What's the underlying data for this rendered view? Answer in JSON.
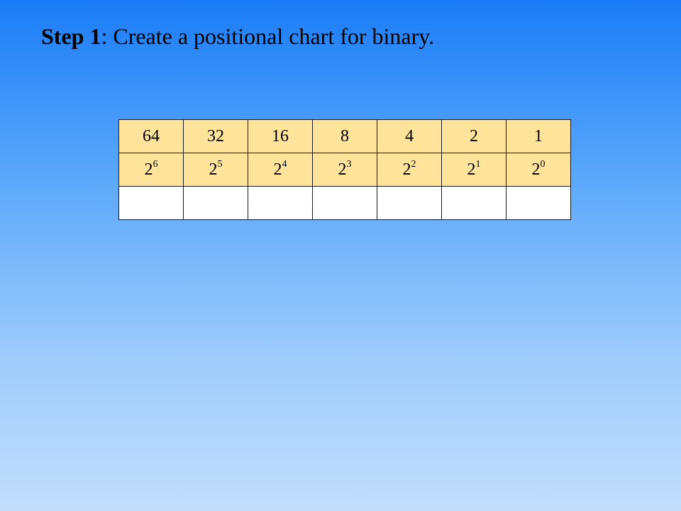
{
  "slide": {
    "title_bold": "Step 1",
    "title_rest": ": Create a positional chart for binary."
  },
  "chart_table": {
    "values": [
      "64",
      "32",
      "16",
      "8",
      "4",
      "2",
      "1"
    ],
    "powers": [
      {
        "base": "2",
        "exp": "6"
      },
      {
        "base": "2",
        "exp": "5"
      },
      {
        "base": "2",
        "exp": "4"
      },
      {
        "base": "2",
        "exp": "3"
      },
      {
        "base": "2",
        "exp": "2"
      },
      {
        "base": "2",
        "exp": "1"
      },
      {
        "base": "2",
        "exp": "0"
      }
    ]
  },
  "colors": {
    "header_fill": "#fde49a",
    "blank_fill": "#ffffff",
    "background_top": "#1a7cf6",
    "background_bottom": "#c3defc"
  }
}
